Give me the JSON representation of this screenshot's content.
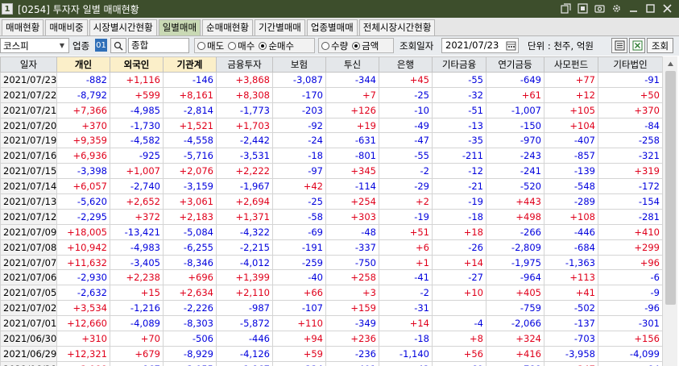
{
  "window": {
    "badge": "1",
    "title": "[0254] 투자자 일별 매매현황"
  },
  "tabs": [
    {
      "label": "매매현황",
      "active": false
    },
    {
      "label": "매매비중",
      "active": false
    },
    {
      "label": "시장별시간현황",
      "active": false
    },
    {
      "label": "일별매매",
      "active": true
    },
    {
      "label": "순매매현황",
      "active": false
    },
    {
      "label": "기간별매매",
      "active": false
    },
    {
      "label": "업종별매매",
      "active": false
    },
    {
      "label": "전체시장시간현황",
      "active": false
    }
  ],
  "toolbar": {
    "market_value": "코스피",
    "sector_label": "업종",
    "sector_code": "01",
    "sector_name": "종합",
    "trade_type": [
      {
        "label": "매도",
        "selected": false
      },
      {
        "label": "매수",
        "selected": false
      },
      {
        "label": "순매수",
        "selected": true
      }
    ],
    "unit_type": [
      {
        "label": "수량",
        "selected": false
      },
      {
        "label": "금액",
        "selected": true
      }
    ],
    "date_label": "조회일자",
    "date_value": "2021/07/23",
    "unit_text": "단위 : 천주, 억원",
    "query_label": "조회"
  },
  "table": {
    "headers": [
      "일자",
      "개인",
      "외국인",
      "기관계",
      "금융투자",
      "보험",
      "투신",
      "은행",
      "기타금융",
      "연기금등",
      "사모펀드",
      "기타법인"
    ],
    "rows": [
      [
        "2021/07/23",
        "-882",
        "+1,116",
        "-146",
        "+3,868",
        "-3,087",
        "-344",
        "+45",
        "-55",
        "-649",
        "+77",
        "-91"
      ],
      [
        "2021/07/22",
        "-8,792",
        "+599",
        "+8,161",
        "+8,308",
        "-170",
        "+7",
        "-25",
        "-32",
        "+61",
        "+12",
        "+50"
      ],
      [
        "2021/07/21",
        "+7,366",
        "-4,985",
        "-2,814",
        "-1,773",
        "-203",
        "+126",
        "-10",
        "-51",
        "-1,007",
        "+105",
        "+370"
      ],
      [
        "2021/07/20",
        "+370",
        "-1,730",
        "+1,521",
        "+1,703",
        "-92",
        "+19",
        "-49",
        "-13",
        "-150",
        "+104",
        "-84"
      ],
      [
        "2021/07/19",
        "+9,359",
        "-4,582",
        "-4,558",
        "-2,442",
        "-24",
        "-631",
        "-47",
        "-35",
        "-970",
        "-407",
        "-258"
      ],
      [
        "2021/07/16",
        "+6,936",
        "-925",
        "-5,716",
        "-3,531",
        "-18",
        "-801",
        "-55",
        "-211",
        "-243",
        "-857",
        "-321"
      ],
      [
        "2021/07/15",
        "-3,398",
        "+1,007",
        "+2,076",
        "+2,222",
        "-97",
        "+345",
        "-2",
        "-12",
        "-241",
        "-139",
        "+319"
      ],
      [
        "2021/07/14",
        "+6,057",
        "-2,740",
        "-3,159",
        "-1,967",
        "+42",
        "-114",
        "-29",
        "-21",
        "-520",
        "-548",
        "-172"
      ],
      [
        "2021/07/13",
        "-5,620",
        "+2,652",
        "+3,061",
        "+2,694",
        "-25",
        "+254",
        "+2",
        "-19",
        "+443",
        "-289",
        "-154"
      ],
      [
        "2021/07/12",
        "-2,295",
        "+372",
        "+2,183",
        "+1,371",
        "-58",
        "+303",
        "-19",
        "-18",
        "+498",
        "+108",
        "-281"
      ],
      [
        "2021/07/09",
        "+18,005",
        "-13,421",
        "-5,084",
        "-4,322",
        "-69",
        "-48",
        "+51",
        "+18",
        "-266",
        "-446",
        "+410"
      ],
      [
        "2021/07/08",
        "+10,942",
        "-4,983",
        "-6,255",
        "-2,215",
        "-191",
        "-337",
        "+6",
        "-26",
        "-2,809",
        "-684",
        "+299"
      ],
      [
        "2021/07/07",
        "+11,632",
        "-3,405",
        "-8,346",
        "-4,012",
        "-259",
        "-750",
        "+1",
        "+14",
        "-1,975",
        "-1,363",
        "+96"
      ],
      [
        "2021/07/06",
        "-2,930",
        "+2,238",
        "+696",
        "+1,399",
        "-40",
        "+258",
        "-41",
        "-27",
        "-964",
        "+113",
        "-6"
      ],
      [
        "2021/07/05",
        "-2,632",
        "+15",
        "+2,634",
        "+2,110",
        "+66",
        "+3",
        "-2",
        "+10",
        "+405",
        "+41",
        "-9"
      ],
      [
        "2021/07/02",
        "+3,534",
        "-1,216",
        "-2,226",
        "-987",
        "-107",
        "+159",
        "-31",
        "",
        "-759",
        "-502",
        "-96"
      ],
      [
        "2021/07/01",
        "+12,660",
        "-4,089",
        "-8,303",
        "-5,872",
        "+110",
        "-349",
        "+14",
        "-4",
        "-2,066",
        "-137",
        "-301"
      ],
      [
        "2021/06/30",
        "+310",
        "+70",
        "-506",
        "-446",
        "+94",
        "+236",
        "-18",
        "+8",
        "+324",
        "-703",
        "+156"
      ],
      [
        "2021/06/29",
        "+12,321",
        "+679",
        "-8,929",
        "-4,126",
        "+59",
        "-236",
        "-1,140",
        "+56",
        "+416",
        "-3,958",
        "-4,099"
      ],
      [
        "2021/06/28",
        "+3,988",
        "-867",
        "-3,055",
        "-1,867",
        "-234",
        "-401",
        "-42",
        "-69",
        "-788",
        "+347",
        "-84"
      ]
    ]
  },
  "colors": {
    "titlebar": "#3d4e2c",
    "positive": "#e0001b",
    "negative": "#0000dd",
    "selected_header": "#fbefc9",
    "active_tab": "#c9d9b4"
  }
}
